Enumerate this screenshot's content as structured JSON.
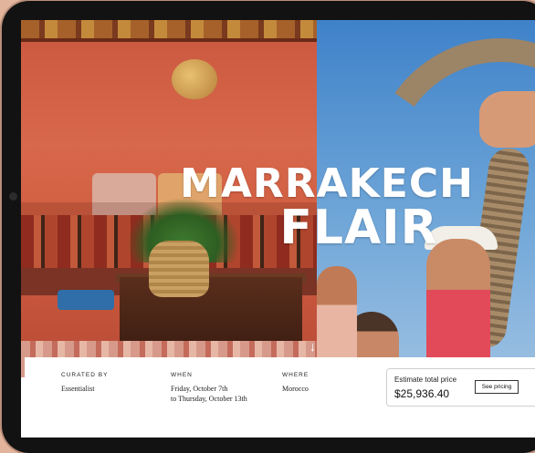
{
  "hero": {
    "title_line1": "MARRAKECH",
    "title_line2": "FLAIR",
    "scroll_glyph": "↓"
  },
  "booking": {
    "curated_by": {
      "label": "CURATED BY",
      "value": "Essentialist"
    },
    "when": {
      "label": "WHEN",
      "line1": "Friday, October 7th",
      "line2": "to Thursday, October 13th"
    },
    "where": {
      "label": "WHERE",
      "value": "Morocco"
    },
    "price": {
      "label": "Estimate total price",
      "value": "$25,936.40",
      "button_label": "See pricing"
    }
  },
  "colors": {
    "device_frame": "#121212",
    "background": "#e3b49c",
    "wall_red": "#d8684b",
    "sky_blue": "#3f82c9"
  }
}
